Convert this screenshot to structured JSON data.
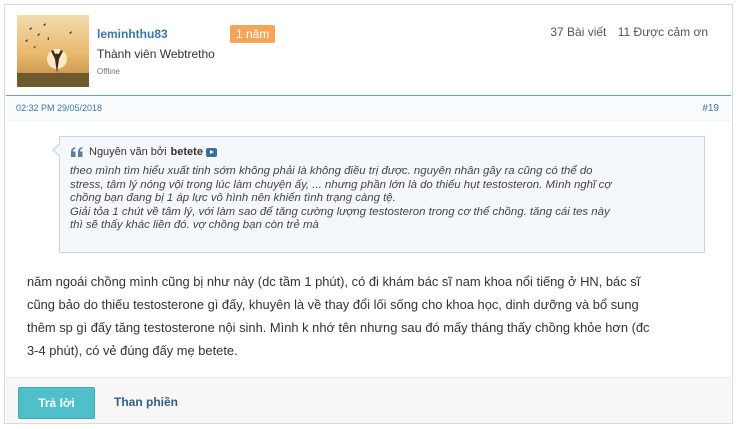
{
  "user": {
    "username": "leminhthu83",
    "badge": "1 năm",
    "role": "Thành viên Webtretho",
    "status": "Offline",
    "posts": "37 Bài viết",
    "thanks": "11 Được cảm ơn"
  },
  "meta": {
    "date": "02:32 PM 29/05/2018",
    "post_number": "#19"
  },
  "quote": {
    "prefix": "Nguyên văn bởi",
    "author": "betete",
    "lines": [
      "theo mình tìm hiểu xuất tinh sớm không phải là không điều trị được. nguyên nhân gây ra cũng có thể do",
      "stress, tâm lý nóng vội trong lúc làm chuyện ấy, ... nhưng phần lớn là do thiếu hụt testosteron. Mình nghĩ cợ",
      "chồng bạn đang bị 1 áp lực vô hình nên khiến tình trạng càng tệ.",
      "Giải tỏa 1 chút về tâm lý, với làm sao để tăng cường lượng testosteron trong cơ thể chồng. tăng cái tes này",
      "thì sẽ thấy khác liền đó. vợ chồng bạn còn trẻ mà"
    ]
  },
  "body": {
    "lines": [
      "năm ngoái chồng mình cũng bị như này (dc tầm 1 phút), có đi khám bác sĩ nam khoa nổi tiếng ở HN, bác sĩ",
      "cũng bảo do thiếu testosterone gì đấy, khuyên là về thay đổi lối sống cho khoa học, dinh dưỡng và bổ sung",
      "thêm sp gì đấy tăng testosterone nội sinh. Mình k nhớ tên nhưng sau đó mấy tháng thấy chồng khỏe hơn (đc",
      "3-4 phút), có vẻ đúng đấy mẹ betete."
    ]
  },
  "actions": {
    "reply": "Trả lời",
    "report": "Than phiền"
  },
  "colors": {
    "accent": "#3a77a8",
    "badge": "#f5a55a",
    "reply_button": "#4fc0c9"
  }
}
